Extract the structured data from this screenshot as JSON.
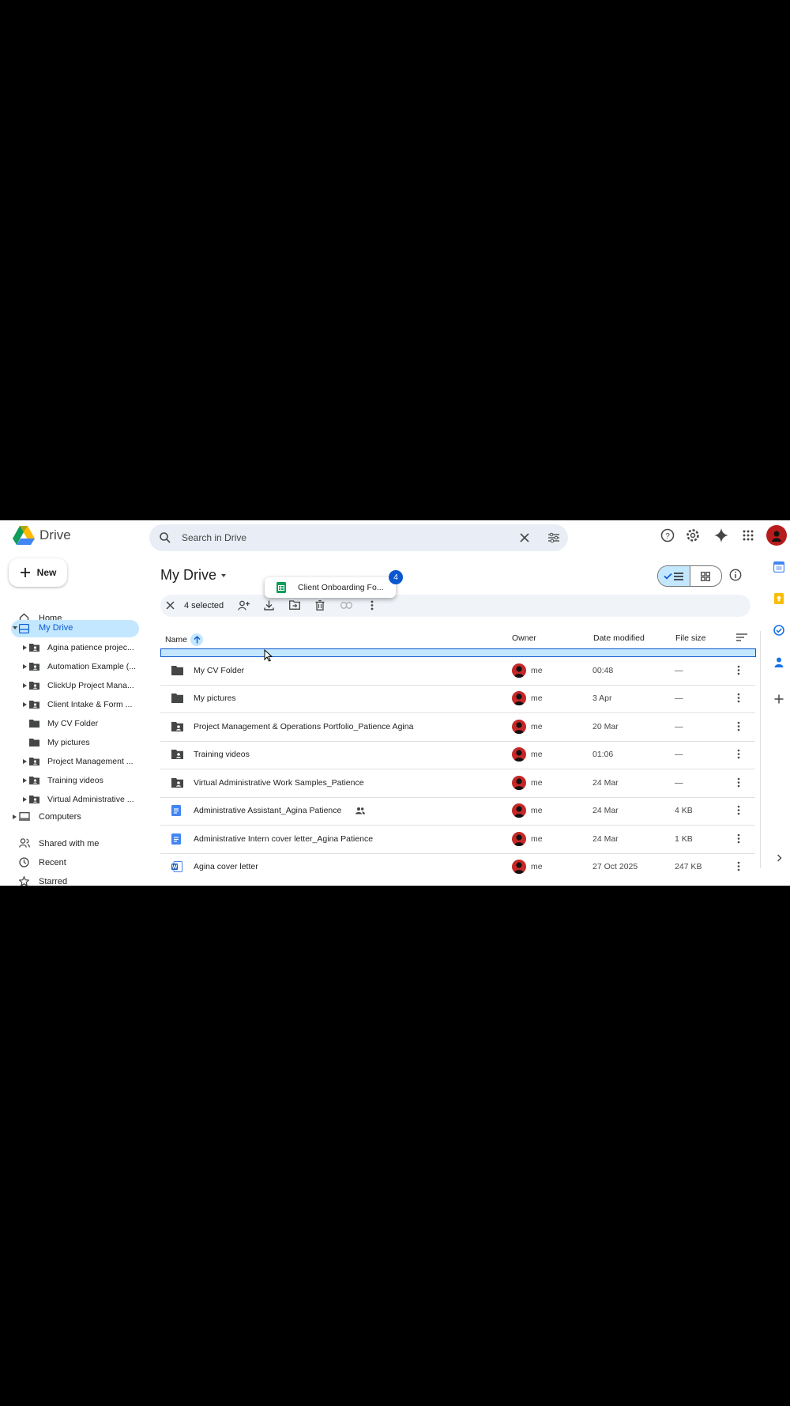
{
  "header": {
    "app_name": "Drive",
    "search_placeholder": "Search in Drive"
  },
  "sidebar": {
    "new_label": "New",
    "home": "Home",
    "my_drive": "My Drive",
    "tree": [
      "Agina patience projec...",
      "Automation Example (...",
      "ClickUp Project Mana...",
      "Client Intake & Form ...",
      "My CV Folder",
      "My pictures",
      "Project Management ...",
      "Training videos",
      "Virtual Administrative ..."
    ],
    "computers": "Computers",
    "shared": "Shared with me",
    "recent": "Recent",
    "starred": "Starred"
  },
  "main": {
    "title": "My Drive",
    "selection": {
      "count_label": "4 selected"
    },
    "columns": {
      "name": "Name",
      "owner": "Owner",
      "date": "Date modified",
      "size": "File size"
    },
    "drag": {
      "file": "Client Onboarding Fo...",
      "count": "4"
    },
    "rows": [
      {
        "name": "My CV Folder",
        "type": "folder",
        "owner": "me",
        "date": "00:48",
        "size": "—"
      },
      {
        "name": "My pictures",
        "type": "folder",
        "owner": "me",
        "date": "3 Apr",
        "size": "—"
      },
      {
        "name": "Project Management & Operations Portfolio_Patience Agina",
        "type": "shared-folder",
        "owner": "me",
        "date": "20 Mar",
        "size": "—"
      },
      {
        "name": "Training videos",
        "type": "shared-folder",
        "owner": "me",
        "date": "01:06",
        "size": "—"
      },
      {
        "name": "Virtual Administrative Work Samples_Patience",
        "type": "shared-folder",
        "owner": "me",
        "date": "24 Mar",
        "size": "—"
      },
      {
        "name": "Administrative Assistant_Agina Patience",
        "type": "doc",
        "shared": true,
        "owner": "me",
        "date": "24 Mar",
        "size": "4 KB"
      },
      {
        "name": "Administrative Intern cover letter_Agina Patience",
        "type": "doc",
        "owner": "me",
        "date": "24 Mar",
        "size": "1 KB"
      },
      {
        "name": "Agina cover letter",
        "type": "word",
        "owner": "me",
        "date": "27 Oct 2025",
        "size": "247 KB"
      }
    ]
  },
  "colors": {
    "accent": "#0b57d0",
    "selected_bg": "#c2e7ff",
    "surface": "#f0f4f9"
  }
}
